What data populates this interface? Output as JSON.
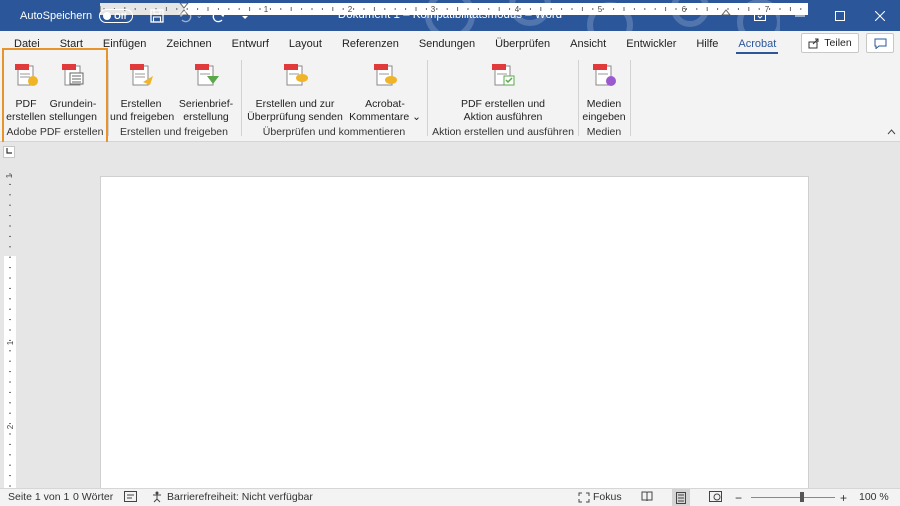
{
  "titlebar": {
    "autosave_label": "AutoSpeichern",
    "autosave_state": "Off",
    "title": "Dokument 1  –  Kompatibilitätsmodus  –  Word"
  },
  "tabs": [
    {
      "label": "Datei"
    },
    {
      "label": "Start"
    },
    {
      "label": "Einfügen"
    },
    {
      "label": "Zeichnen"
    },
    {
      "label": "Entwurf"
    },
    {
      "label": "Layout"
    },
    {
      "label": "Referenzen"
    },
    {
      "label": "Sendungen"
    },
    {
      "label": "Überprüfen"
    },
    {
      "label": "Ansicht"
    },
    {
      "label": "Entwickler"
    },
    {
      "label": "Hilfe"
    },
    {
      "label": "Acrobat"
    }
  ],
  "share_label": "Teilen",
  "ribbon": {
    "groups": [
      {
        "label": "Adobe PDF erstellen",
        "buttons": [
          {
            "line1": "PDF",
            "line2": "erstellen"
          },
          {
            "line1": "Grundein-",
            "line2": "stellungen"
          }
        ]
      },
      {
        "label": "Erstellen und freigeben",
        "buttons": [
          {
            "line1": "Erstellen",
            "line2": "und freigeben"
          },
          {
            "line1": "Serienbrief-",
            "line2": "erstellung"
          }
        ]
      },
      {
        "label": "Überprüfen und kommentieren",
        "buttons": [
          {
            "line1": "Erstellen und zur",
            "line2": "Überprüfung senden"
          },
          {
            "line1": "Acrobat-",
            "line2": "Kommentare ⌄"
          }
        ]
      },
      {
        "label": "Aktion erstellen und ausführen",
        "buttons": [
          {
            "line1": "PDF erstellen und",
            "line2": "Aktion ausführen"
          }
        ]
      },
      {
        "label": "Medien",
        "buttons": [
          {
            "line1": "Medien",
            "line2": "eingeben"
          }
        ]
      }
    ]
  },
  "ruler": {
    "h_labels": [
      "1",
      "1",
      "2",
      "3",
      "4",
      "5",
      "6",
      "7"
    ],
    "v_labels": [
      "1",
      "1",
      "2"
    ]
  },
  "statusbar": {
    "page": "Seite 1 von 1",
    "words": "0 Wörter",
    "accessibility": "Barrierefreiheit: Nicht verfügbar",
    "focus": "Fokus",
    "zoom": "100 %",
    "zoom_percent": 100
  },
  "colors": {
    "word_blue": "#2b579a",
    "highlight_orange": "#e8942c",
    "pdf_red": "#e03a3a"
  },
  "icons": [
    "save-icon",
    "undo-icon",
    "redo-icon",
    "customize-icon",
    "share-icon",
    "comment-icon"
  ]
}
